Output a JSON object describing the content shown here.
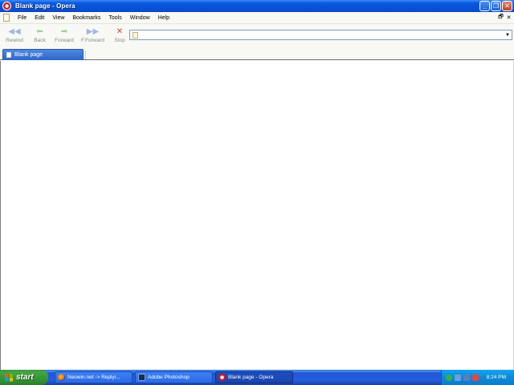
{
  "window": {
    "title": "Blank page - Opera",
    "buttons": {
      "minimize": "_",
      "maximize": "❐",
      "close": "✕"
    }
  },
  "menubar": {
    "items": [
      "File",
      "Edit",
      "View",
      "Bookmarks",
      "Tools",
      "Window",
      "Help"
    ],
    "mdi_restore": "🗗",
    "mdi_close": "✕"
  },
  "toolbar": {
    "buttons": [
      {
        "label": "Rewind",
        "icon": "rewind-icon"
      },
      {
        "label": "Back",
        "icon": "back-icon"
      },
      {
        "label": "Forward",
        "icon": "forward-icon"
      },
      {
        "label": "F.Forward",
        "icon": "fast-forward-icon"
      },
      {
        "label": "Stop",
        "icon": "stop-icon"
      }
    ],
    "address": {
      "value": "",
      "placeholder": ""
    }
  },
  "tabs": [
    {
      "label": "Blank page",
      "active": true
    }
  ],
  "taskbar": {
    "start_label": "start",
    "tasks": [
      {
        "label": "Neowin.net -> Replyi...",
        "icon": "firefox-icon"
      },
      {
        "label": "Adobe Photoshop",
        "icon": "photoshop-icon"
      },
      {
        "label": "Blank page - Opera",
        "icon": "opera-icon",
        "active": true
      }
    ],
    "clock": "8:24 PM"
  },
  "colors": {
    "titlebar": "#0652d8",
    "taskbar": "#245edb",
    "start_button": "#3c9b3c",
    "active_tab": "#2d66c9"
  }
}
